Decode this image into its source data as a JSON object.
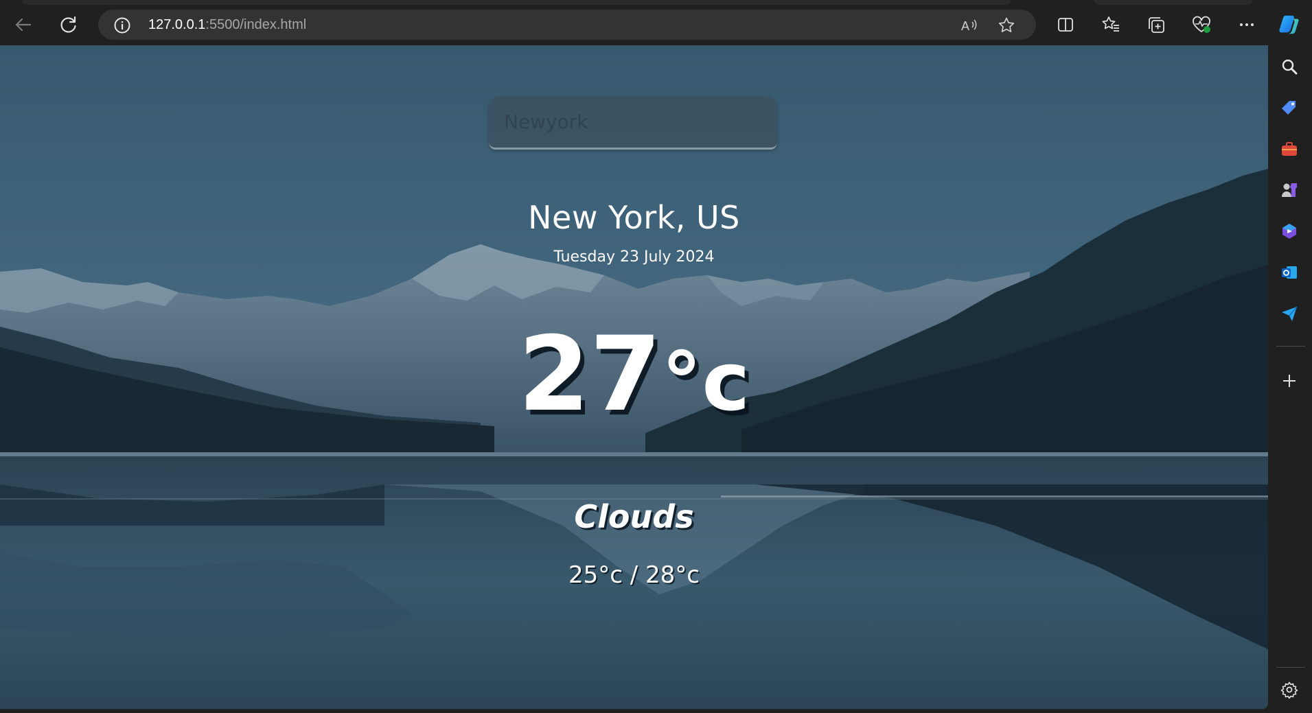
{
  "browser": {
    "address": {
      "host": "127.0.0.1",
      "rest": ":5500/index.html"
    },
    "toolbar_icons": [
      "back-icon",
      "refresh-icon",
      "info-icon",
      "read-aloud-icon",
      "favorite-star-icon",
      "split-screen-icon",
      "favorites-icon",
      "collections-icon",
      "browser-essentials-icon",
      "more-icon",
      "copilot-icon"
    ],
    "sidebar_icons": [
      "search-icon",
      "shopping-tag-icon",
      "tools-icon",
      "games-icon",
      "microsoft-365-icon",
      "outlook-icon",
      "drop-icon",
      "add-icon",
      "settings-icon"
    ]
  },
  "weather": {
    "search": {
      "placeholder": "Newyork"
    },
    "city": "New York, US",
    "date": "Tuesday 23 July 2024",
    "temp_value": "27",
    "temp_unit": "°c",
    "condition": "Clouds",
    "hilow": "25°c / 28°c"
  },
  "colors": {
    "chrome_bg": "#202020",
    "address_bg": "#333333",
    "sky": "#3e6076",
    "text": "#ffffff"
  }
}
